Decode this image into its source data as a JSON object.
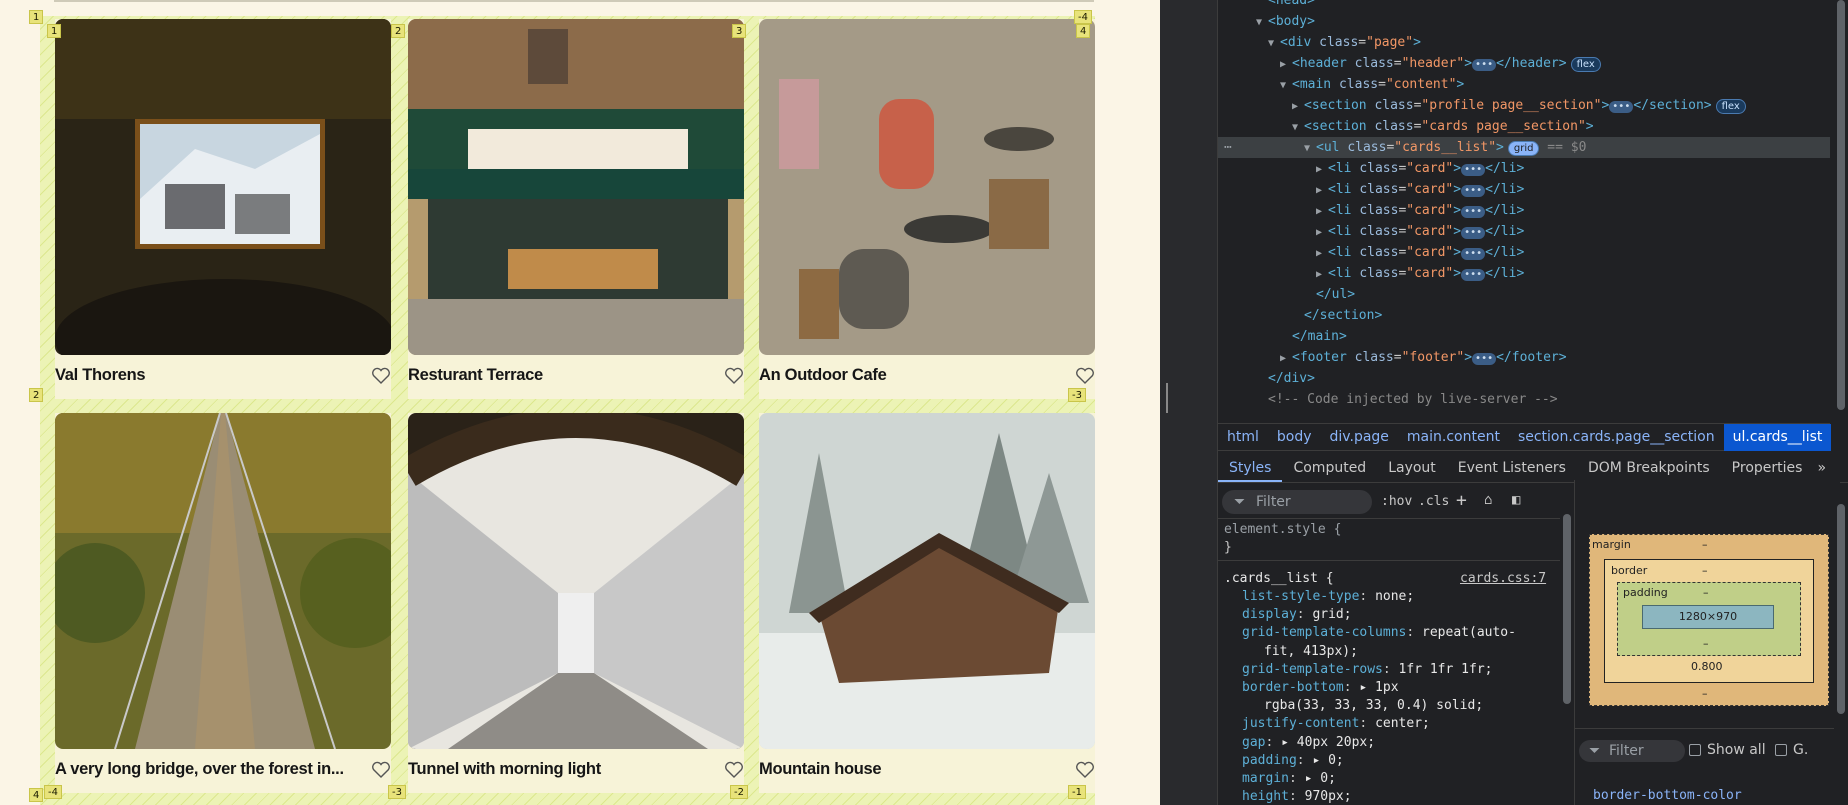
{
  "cards": [
    {
      "title": "Val Thorens"
    },
    {
      "title": "Resturant Terrace"
    },
    {
      "title": "An Outdoor Cafe"
    },
    {
      "title": "A very long bridge, over the forest in..."
    },
    {
      "title": "Tunnel with morning light"
    },
    {
      "title": "Mountain house"
    }
  ],
  "grid_labels": {
    "top": [
      "1",
      "2",
      "3",
      "4",
      "-4"
    ],
    "left": [
      "1",
      "2",
      "4"
    ],
    "bottom": [
      "-4",
      "-3",
      "-2",
      "-1"
    ],
    "right": [
      "-3"
    ]
  },
  "devtools": {
    "dom": {
      "head": "<head>",
      "body": "<body>",
      "div_page": [
        "div",
        "class",
        "page"
      ],
      "header": [
        "header",
        "class",
        "header"
      ],
      "main": [
        "main",
        "class",
        "content"
      ],
      "profile": [
        "section",
        "class",
        "profile page__section"
      ],
      "cards_section": [
        "section",
        "class",
        "cards page__section"
      ],
      "ul": [
        "ul",
        "class",
        "cards__list"
      ],
      "li_class": "card",
      "footer": [
        "footer",
        "class",
        "footer"
      ],
      "comment": "<!-- Code injected by live-server -->",
      "badge_flex": "flex",
      "badge_grid": "grid",
      "eq": "== $0"
    },
    "breadcrumb": [
      "html",
      "body",
      "div.page",
      "main.content",
      "section.cards.page__section",
      "ul.cards__list"
    ],
    "tabs": [
      "Styles",
      "Computed",
      "Layout",
      "Event Listeners",
      "DOM Breakpoints",
      "Properties"
    ],
    "filter_placeholder": "Filter",
    "hov": ":hov",
    "cls": ".cls",
    "element_style": "element.style {",
    "rule": {
      "selector": ".cards__list {",
      "source": "cards.css:7",
      "decls": [
        [
          "list-style-type",
          "none;"
        ],
        [
          "display",
          "grid;"
        ],
        [
          "grid-template-columns",
          "repeat(auto-"
        ],
        [
          "",
          "fit, 413px);"
        ],
        [
          "grid-template-rows",
          "1fr 1fr 1fr;"
        ],
        [
          "border-bottom",
          "▸ 1px"
        ],
        [
          "",
          "rgba(33, 33, 33, 0.4) solid;"
        ],
        [
          "justify-content",
          "center;"
        ],
        [
          "gap",
          "▸ 40px 20px;"
        ],
        [
          "padding",
          "▸ 0;"
        ],
        [
          "margin",
          "▸ 0;"
        ],
        [
          "height",
          "970px;"
        ]
      ]
    },
    "box_model": {
      "margin": "margin",
      "border": "border",
      "padding": "padding",
      "content": "1280×970",
      "border_bottom": "0.800",
      "dash": "–"
    },
    "computed_filter": "Filter",
    "show_all": "Show all",
    "g": "G.",
    "computed_first": "border-bottom-color"
  }
}
